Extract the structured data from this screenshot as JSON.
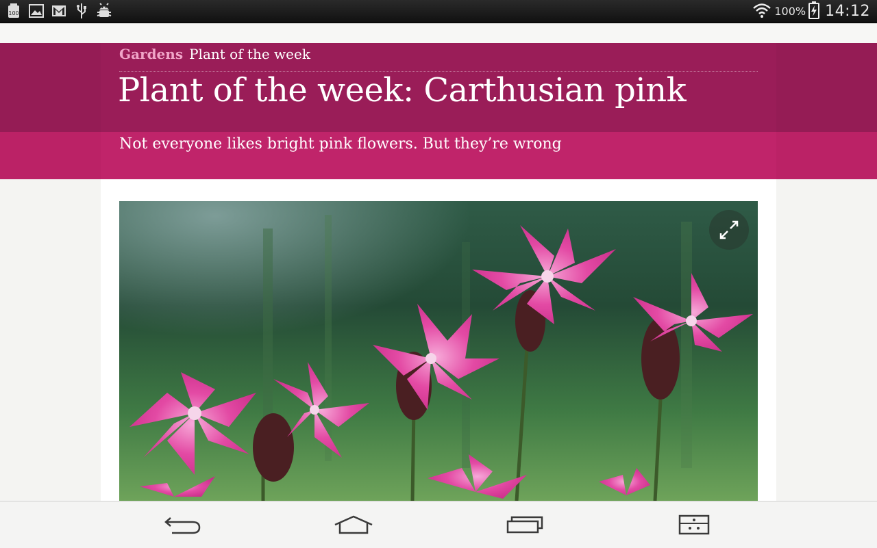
{
  "status_bar": {
    "notification_icons": [
      "storage-icon",
      "gallery-icon",
      "gmail-icon",
      "usb-icon",
      "android-debug-icon"
    ],
    "battery_percent": "100%",
    "time": "14:12"
  },
  "article": {
    "section": "Gardens",
    "series": "Plant of the week",
    "headline": "Plant of the week: Carthusian pink",
    "standfirst": "Not everyone likes bright pink flowers. But they’re wrong"
  },
  "colors": {
    "header": "#9a1d58",
    "standfirst": "#c0246a",
    "section_label": "#f0a5c8"
  },
  "nav_bar": {
    "buttons": [
      "back-icon",
      "home-icon",
      "recent-apps-icon",
      "menu-icon"
    ]
  }
}
